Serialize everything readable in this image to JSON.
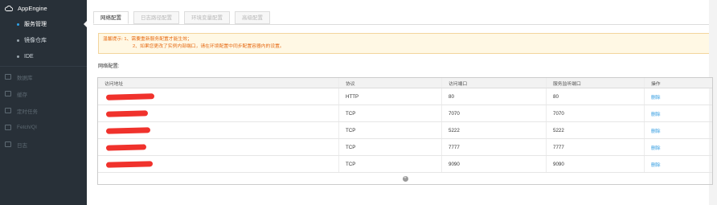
{
  "sidebar": {
    "app_title": "AppEngine",
    "sub_items": [
      {
        "label": "服务管理",
        "active": true
      },
      {
        "label": "镜像仓库",
        "active": false
      },
      {
        "label": "IDE",
        "active": false
      }
    ],
    "items": [
      {
        "label": "数据库",
        "icon": "database-icon"
      },
      {
        "label": "缓存",
        "icon": "cache-icon"
      },
      {
        "label": "定时任务",
        "icon": "clock-icon"
      },
      {
        "label": "Fetch/QI",
        "icon": "fetch-icon"
      },
      {
        "label": "日志",
        "icon": "log-icon"
      }
    ]
  },
  "tabs": [
    {
      "label": "网络配置",
      "active": true
    },
    {
      "label": "日志路径配置",
      "active": false
    },
    {
      "label": "环境变量配置",
      "active": false
    },
    {
      "label": "高级配置",
      "active": false
    }
  ],
  "notice": {
    "line1": "温馨提示: 1、需要重新服务配置才能生效；",
    "line2": "2、如果您更改了实例内部端口，请在环境配置中同步配置容器内的设置。"
  },
  "network_label": "网络配置:",
  "table": {
    "headers": [
      "访问地址",
      "协议",
      "访问端口",
      "服务监听端口",
      "操作"
    ],
    "rows": [
      {
        "protocol": "HTTP",
        "access_port": "80",
        "listen_port": "80",
        "action": "删除"
      },
      {
        "protocol": "TCP",
        "access_port": "7070",
        "listen_port": "7070",
        "action": "删除"
      },
      {
        "protocol": "TCP",
        "access_port": "5222",
        "listen_port": "5222",
        "action": "删除"
      },
      {
        "protocol": "TCP",
        "access_port": "7777",
        "listen_port": "7777",
        "action": "删除"
      },
      {
        "protocol": "TCP",
        "access_port": "9090",
        "listen_port": "9090",
        "action": "删除"
      }
    ]
  },
  "colors": {
    "sidebar_bg": "#283038",
    "accent": "#2ea3ea",
    "notice_text": "#e66a13",
    "redaction": "#f0322c"
  }
}
